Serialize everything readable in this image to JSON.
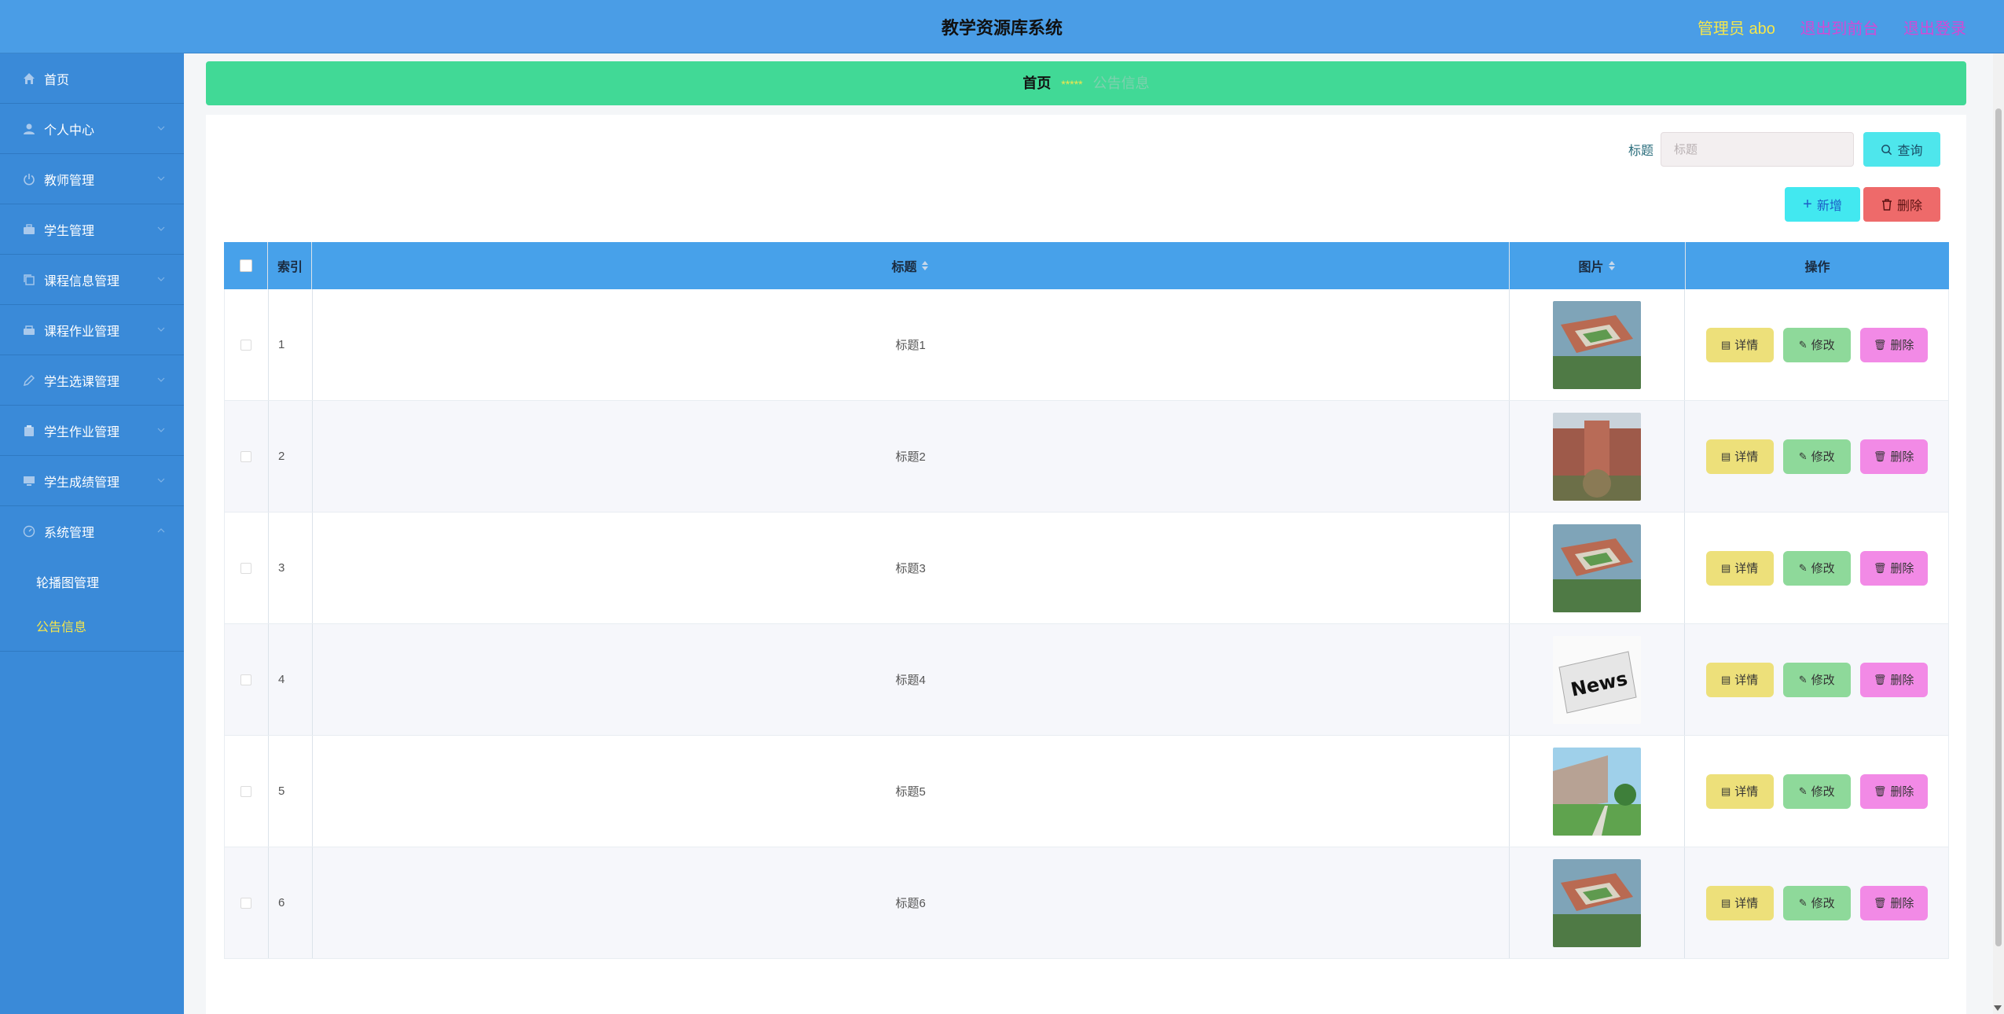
{
  "app": {
    "title": "教学资源库系统"
  },
  "header": {
    "admin": "管理员 abo",
    "to_front": "退出到前台",
    "logout": "退出登录"
  },
  "colors": {
    "topbar": "#4a9de6",
    "sidebar": "#3a8ad8",
    "breadcrumb": "#41d996",
    "accent_yellow": "#f5e64b",
    "link_pink": "#d14ad6"
  },
  "sidebar": {
    "items": [
      {
        "label": "首页",
        "icon": "home-icon"
      },
      {
        "label": "个人中心",
        "icon": "user-icon"
      },
      {
        "label": "教师管理",
        "icon": "power-icon"
      },
      {
        "label": "学生管理",
        "icon": "briefcase-icon"
      },
      {
        "label": "课程信息管理",
        "icon": "copy-icon"
      },
      {
        "label": "课程作业管理",
        "icon": "suitcase-icon"
      },
      {
        "label": "学生选课管理",
        "icon": "edit-icon"
      },
      {
        "label": "学生作业管理",
        "icon": "clipboard-icon"
      },
      {
        "label": "学生成绩管理",
        "icon": "monitor-icon"
      },
      {
        "label": "系统管理",
        "icon": "gauge-icon"
      }
    ],
    "sub_items": [
      {
        "label": "轮播图管理"
      },
      {
        "label": "公告信息"
      }
    ]
  },
  "breadcrumb": {
    "home": "首页",
    "separator": "*****",
    "current": "公告信息"
  },
  "search": {
    "label": "标题",
    "placeholder": "标题",
    "query_button": "查询"
  },
  "toolbar": {
    "add_label": "新增",
    "delete_label": "删除"
  },
  "table": {
    "headers": {
      "index": "索引",
      "title": "标题",
      "picture": "图片",
      "actions": "操作"
    },
    "actions": {
      "detail": "详情",
      "edit": "修改",
      "delete": "删除"
    },
    "rows": [
      {
        "index": "1",
        "title": "标题1",
        "image": "campus-aerial-image"
      },
      {
        "index": "2",
        "title": "标题2",
        "image": "school-building-image"
      },
      {
        "index": "3",
        "title": "标题3",
        "image": "campus-aerial-image"
      },
      {
        "index": "4",
        "title": "标题4",
        "image": "news-newspaper-image"
      },
      {
        "index": "5",
        "title": "标题5",
        "image": "campus-garden-image"
      },
      {
        "index": "6",
        "title": "标题6",
        "image": "campus-aerial-image"
      }
    ]
  }
}
